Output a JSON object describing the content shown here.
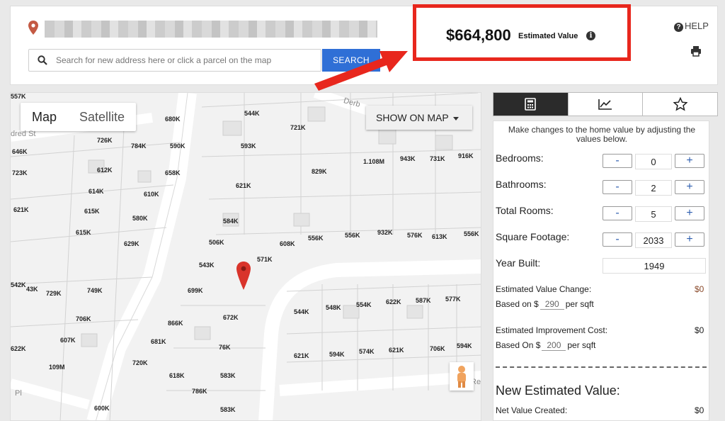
{
  "header": {
    "estimated_value": "$664,800",
    "estimated_value_caption": "Estimated Value",
    "help_label": "HELP",
    "search_placeholder": "Search for new address here or click a parcel on the map",
    "search_button": "SEARCH"
  },
  "map": {
    "type_map": "Map",
    "type_satellite": "Satellite",
    "show_on_map": "SHOW ON MAP",
    "streets": [
      "dred St",
      "Derb",
      "Pl",
      "Re"
    ],
    "prices": [
      "680K",
      "544K",
      "721K",
      "726K",
      "784K",
      "590K",
      "593K",
      "646K",
      "612K",
      "658K",
      "829K",
      "1.108M",
      "943K",
      "731K",
      "916K",
      "723K",
      "614K",
      "610K",
      "621K",
      "621K",
      "615K",
      "580K",
      "584K",
      "615K",
      "556K",
      "608K",
      "556K",
      "932K",
      "576K",
      "613K",
      "556K",
      "629K",
      "506K",
      "571K",
      "543K",
      "542K",
      "43K",
      "729K",
      "749K",
      "699K",
      "544K",
      "548K",
      "554K",
      "622K",
      "587K",
      "577K",
      "706K",
      "866K",
      "672K",
      "607K",
      "681K",
      "76K",
      "621K",
      "594K",
      "574K",
      "621K",
      "706K",
      "594K",
      "622K",
      "109M",
      "720K",
      "583K",
      "618K",
      "786K",
      "600K",
      "583K",
      "557K"
    ]
  },
  "panel": {
    "tab_icons": [
      "calculator-icon",
      "chart-icon",
      "star-icon"
    ],
    "intro": "Make changes to the home value by adjusting the values below.",
    "rows": [
      {
        "label": "Bedrooms:",
        "value": "0"
      },
      {
        "label": "Bathrooms:",
        "value": "2"
      },
      {
        "label": "Total Rooms:",
        "value": "5"
      },
      {
        "label": "Square Footage:",
        "value": "2033"
      }
    ],
    "minus": "-",
    "plus": "+",
    "year_built_label": "Year Built:",
    "year_built": "1949",
    "value_change_label": "Estimated Value Change:",
    "value_change": "$0",
    "based_on_1_prefix": "Based on $",
    "based_on_1_value": "290",
    "based_on_1_suffix": "per sqft",
    "improvement_cost_label": "Estimated Improvement Cost:",
    "improvement_cost": "$0",
    "based_on_2_prefix": "Based On $",
    "based_on_2_value": "200",
    "based_on_2_suffix": "per sqft",
    "new_value_title": "New Estimated Value:",
    "net_value_label": "Net Value Created:",
    "net_value": "$0"
  },
  "colors": {
    "accent_blue": "#2f6fd6",
    "highlight_red": "#e8271d",
    "pin_red": "#d9342b"
  }
}
